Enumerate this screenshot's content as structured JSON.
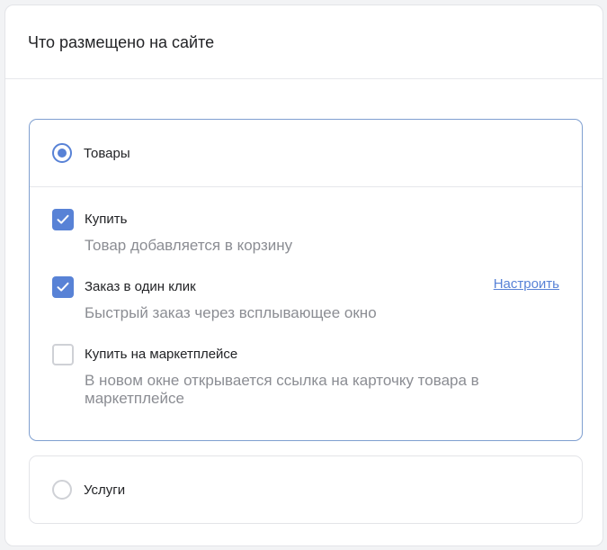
{
  "panel": {
    "title": "Что размещено на сайте"
  },
  "options": {
    "goods": {
      "label": "Товары",
      "selected": true,
      "sub_options": {
        "buy": {
          "title": "Купить",
          "description": "Товар добавляется в корзину",
          "checked": true
        },
        "one_click": {
          "title": "Заказ в один клик",
          "description": "Быстрый заказ через всплывающее окно",
          "checked": true,
          "link_label": "Настроить"
        },
        "marketplace": {
          "title": "Купить на маркетплейсе",
          "description": "В новом окне открывается ссылка на карточку товара в маркетплейсе",
          "checked": false
        }
      }
    },
    "services": {
      "label": "Услуги",
      "selected": false
    }
  },
  "colors": {
    "accent": "#5882d6",
    "card_border_active": "#7f9fd0",
    "text_primary": "#222326",
    "text_secondary": "#8b8d93"
  }
}
